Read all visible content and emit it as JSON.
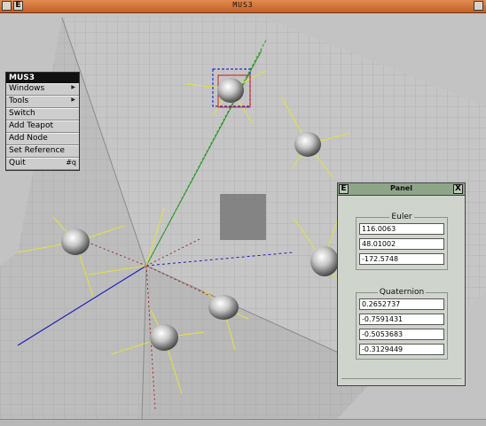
{
  "window": {
    "title": "MUS3"
  },
  "menu": {
    "title": "MUS3",
    "items": [
      {
        "label": "Windows",
        "submenu": true
      },
      {
        "label": "Tools",
        "submenu": true
      },
      {
        "label": "Switch"
      },
      {
        "label": "Add Teapot"
      },
      {
        "label": "Add Node"
      },
      {
        "label": "Set Reference"
      },
      {
        "label": "Quit",
        "shortcut": "#q"
      }
    ]
  },
  "panel": {
    "title": "Panel",
    "euler": {
      "label": "Euler",
      "values": [
        "116.0063",
        "48.01002",
        "-172.5748"
      ]
    },
    "quaternion": {
      "label": "Quaternion",
      "values": [
        "0.2652737",
        "-0.7591431",
        "-0.5053683",
        "-0.3129449"
      ]
    }
  }
}
